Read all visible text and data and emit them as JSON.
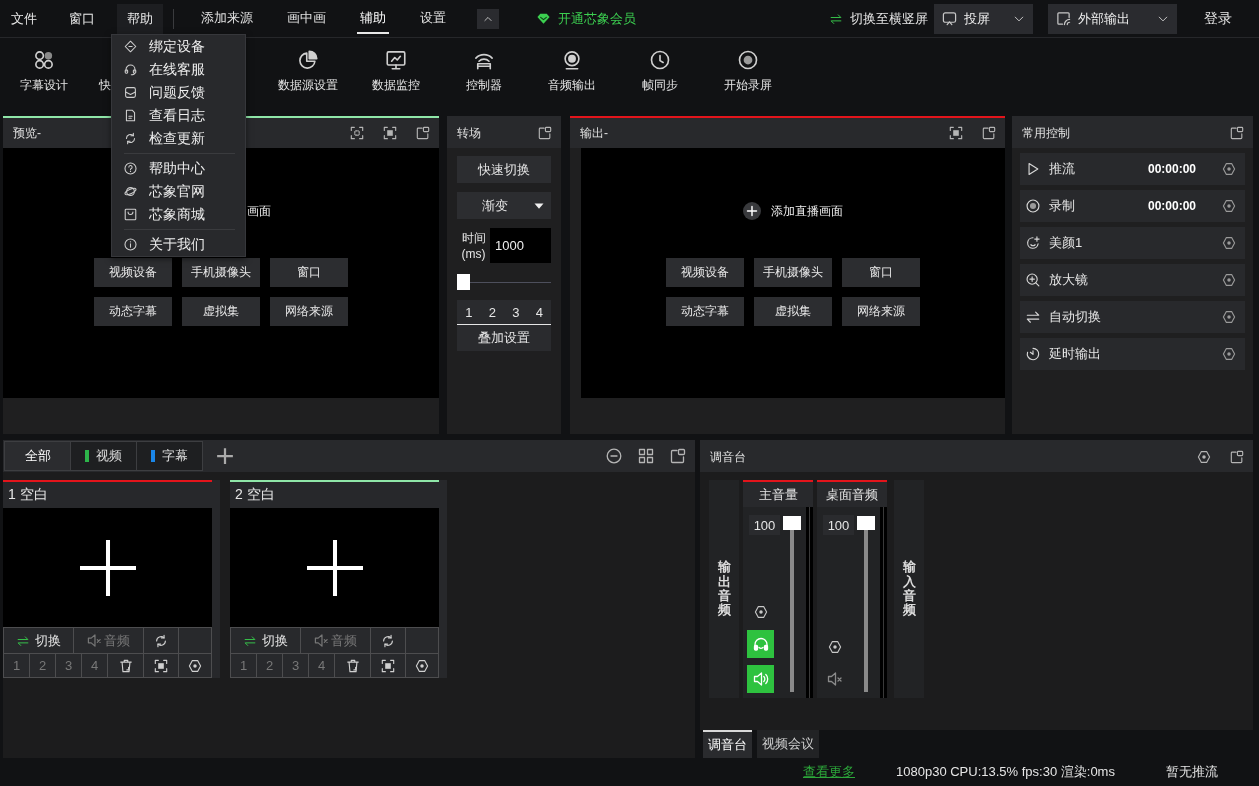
{
  "menu_bar": {
    "menus": [
      {
        "label": "文件",
        "selected": false
      },
      {
        "label": "窗口",
        "selected": false
      },
      {
        "label": "帮助",
        "selected": true
      }
    ],
    "tabs": [
      {
        "label": "添加来源",
        "selected": false
      },
      {
        "label": "画中画",
        "selected": false
      },
      {
        "label": "辅助",
        "selected": true
      },
      {
        "label": "设置",
        "selected": false
      }
    ],
    "vip": "开通芯象会员",
    "orientation": "切换至横竖屏",
    "cast": "投屏",
    "external_output": "外部输出",
    "login": "登录"
  },
  "help_menu": {
    "sections": [
      {
        "items": [
          "绑定设备",
          "在线客服",
          "问题反馈",
          "查看日志",
          "检查更新"
        ]
      },
      {
        "items": [
          "帮助中心",
          "芯象官网",
          "芯象商城"
        ]
      },
      {
        "items": [
          "关于我们"
        ]
      }
    ]
  },
  "toolbar": [
    {
      "label": "字幕设计",
      "kind": "tool"
    },
    {
      "label": "快",
      "kind": "covered"
    },
    {
      "label": "数据源设置",
      "kind": "tool"
    },
    {
      "label": "数据监控",
      "kind": "tool"
    },
    {
      "label": "控制器",
      "kind": "tool"
    },
    {
      "label": "音频输出",
      "kind": "tool"
    },
    {
      "label": "帧同步",
      "kind": "tool"
    },
    {
      "label": "开始录屏",
      "kind": "tool"
    }
  ],
  "preview": {
    "title": "预览-",
    "add_label": "画面",
    "sources": [
      "视频设备",
      "手机摄像头",
      "窗口",
      "动态字幕",
      "虚拟集",
      "网络来源"
    ]
  },
  "transition": {
    "title": "转场",
    "quick_switch": "快速切换",
    "effect": "渐变",
    "time_label": "时间",
    "time_unit": "(ms)",
    "time_value": "1000",
    "slider": {
      "level": 0
    },
    "layers": [
      "1",
      "2",
      "3",
      "4"
    ],
    "overlay": "叠加设置"
  },
  "output": {
    "title": "输出-",
    "add_label": "添加直播画面",
    "sources": [
      "视频设备",
      "手机摄像头",
      "窗口",
      "动态字幕",
      "虚拟集",
      "网络来源"
    ]
  },
  "common_controls": {
    "title": "常用控制",
    "items": [
      {
        "label": "推流",
        "time": "00:00:00"
      },
      {
        "label": "录制",
        "time": "00:00:00"
      },
      {
        "label": "美颜1"
      },
      {
        "label": "放大镜"
      },
      {
        "label": "自动切换"
      },
      {
        "label": "延时输出"
      }
    ]
  },
  "scenes": {
    "tabs": [
      {
        "label": "全部",
        "selected": true
      },
      {
        "label": "视频",
        "selected": false,
        "color": "#2db54a"
      },
      {
        "label": "字幕",
        "selected": false,
        "color": "#1a86e8"
      }
    ],
    "cards": [
      {
        "title": "1 空白",
        "color": "#e3141b",
        "switch": "切换",
        "audio": "音频",
        "audio_muted": true,
        "tracks": [
          "1",
          "2",
          "3",
          "4"
        ]
      },
      {
        "title": "2 空白",
        "color": "#8fe6a8",
        "switch": "切换",
        "audio": "音频",
        "audio_muted": true,
        "tracks": [
          "1",
          "2",
          "3",
          "4"
        ]
      }
    ]
  },
  "mixer": {
    "title": "调音台",
    "output_label": "输出音频",
    "input_label": "输入音频",
    "channels": [
      {
        "name": "主音量",
        "value": "100",
        "level": 1,
        "monitor": true,
        "muted": false
      },
      {
        "name": "桌面音频",
        "value": "100",
        "level": 1,
        "monitor": false,
        "muted": true
      }
    ]
  },
  "bottom_tabs": [
    {
      "label": "调音台",
      "selected": true
    },
    {
      "label": "视频会议",
      "selected": false
    }
  ],
  "status_bar": {
    "link": "查看更多",
    "stats": "1080p30 CPU:13.5% fps:30 渲染:0ms",
    "stream_status": "暂无推流"
  }
}
